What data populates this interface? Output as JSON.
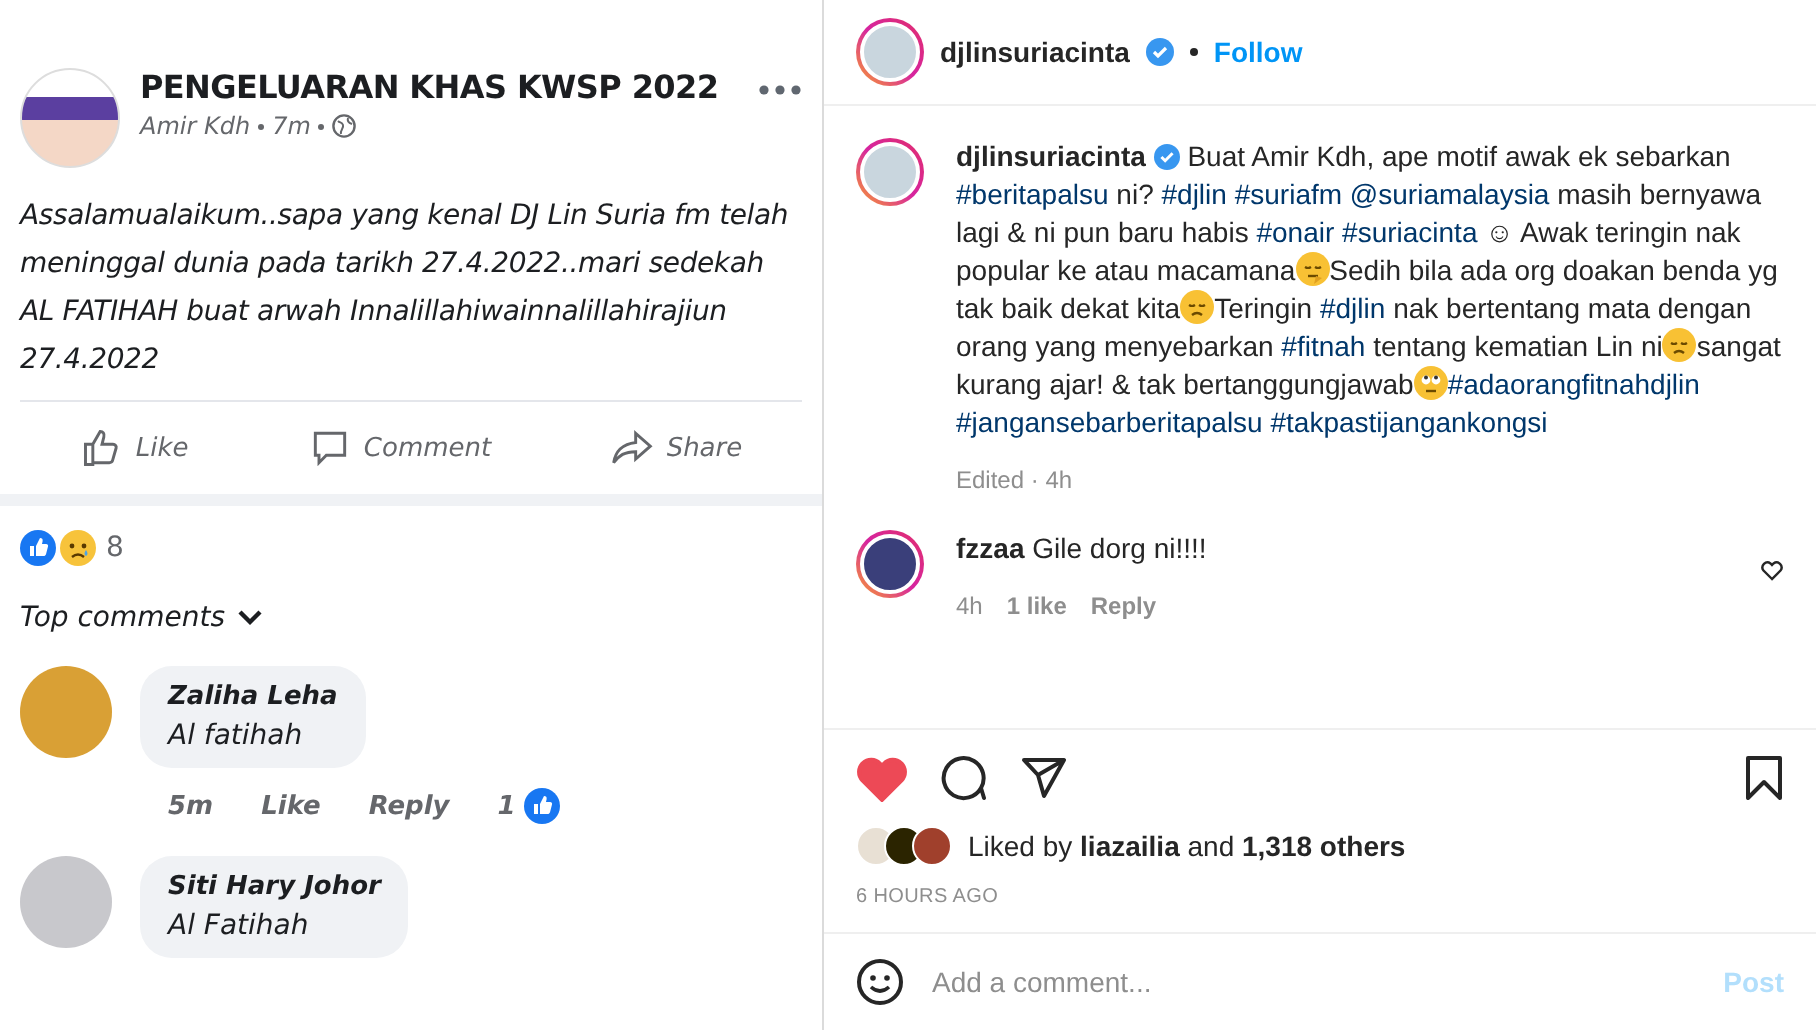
{
  "fb_post": {
    "page_name": "PENGELUARAN KHAS KWSP 2022",
    "author": "Amir Kdh",
    "time": "7m",
    "body": "Assalamualaikum..sapa yang kenal DJ Lin Suria fm telah meninggal dunia pada tarikh 27.4.2022..mari sedekah AL FATIHAH buat arwah Innalillahiwainnalillahirajiun 27.4.2022",
    "actions": [
      {
        "kind": "like",
        "label": "Like"
      },
      {
        "kind": "comment",
        "label": "Comment"
      },
      {
        "kind": "share",
        "label": "Share"
      }
    ],
    "reactions_count": "8",
    "sort_label": "Top comments",
    "comments": [
      {
        "name": "Zaliha Leha",
        "text": "Al fatihah",
        "time": "5m",
        "like": "Like",
        "reply": "Reply",
        "likes": "1"
      },
      {
        "name": "Siti Hary Johor",
        "text": "Al Fatihah"
      }
    ]
  },
  "header": {
    "username": "djlinsuriacinta",
    "follow": "Follow"
  },
  "caption": {
    "username": "djlinsuriacinta",
    "segments": [
      {
        "kind": "text",
        "text": "Buat Amir Kdh, ape motif awak ek sebarkan "
      },
      {
        "kind": "tag",
        "text": "#beritapalsu"
      },
      {
        "kind": "text",
        "text": " ni? "
      },
      {
        "kind": "tag",
        "text": "#djlin"
      },
      {
        "kind": "tag",
        "text": "#suriafm"
      },
      {
        "kind": "tag",
        "text": "@suriamalaysia"
      },
      {
        "kind": "text",
        "text": " masih bernyawa lagi & ni pun baru habis "
      },
      {
        "kind": "tag",
        "text": "#onair"
      },
      {
        "kind": "tag",
        "text": "#suriacinta"
      },
      {
        "kind": "text",
        "text": " ☺ Awak teringin nak popular ke atau macamana"
      },
      {
        "kind": "thinking"
      },
      {
        "kind": "text",
        "text": "Sedih bila ada org doakan benda yg tak baik dekat kita"
      },
      {
        "kind": "pensive"
      },
      {
        "kind": "text",
        "text": "Teringin "
      },
      {
        "kind": "tag",
        "text": "#djlin"
      },
      {
        "kind": "text",
        "text": " nak bertentang mata dengan orang yang menyebarkan "
      },
      {
        "kind": "tag",
        "text": "#fitnah"
      },
      {
        "kind": "text",
        "text": " tentang kematian Lin ni"
      },
      {
        "kind": "pensive"
      },
      {
        "kind": "text",
        "text": "sangat kurang ajar! & tak bertanggungjawab"
      },
      {
        "kind": "eyeroll"
      },
      {
        "kind": "tag",
        "text": "#adaorangfitnahdjlin"
      },
      {
        "kind": "tag",
        "text": "#jangansebarberitapalsu"
      },
      {
        "kind": "tag",
        "text": "#takpastijangankongsi"
      }
    ],
    "meta": "Edited · 4h"
  },
  "comments": [
    {
      "username": "fzzaa",
      "text": "Gile dorg ni!!!!",
      "time": "4h",
      "likes": "1 like",
      "reply": "Reply",
      "liked": false
    }
  ],
  "actions": {
    "liked": true,
    "saved": false
  },
  "likes": "Liked by **liazailia** and **1,318 others**",
  "time": "6 HOURS AGO",
  "add_comment": {
    "placeholder": "Add a comment...",
    "post": "Post",
    "disabled": true
  }
}
